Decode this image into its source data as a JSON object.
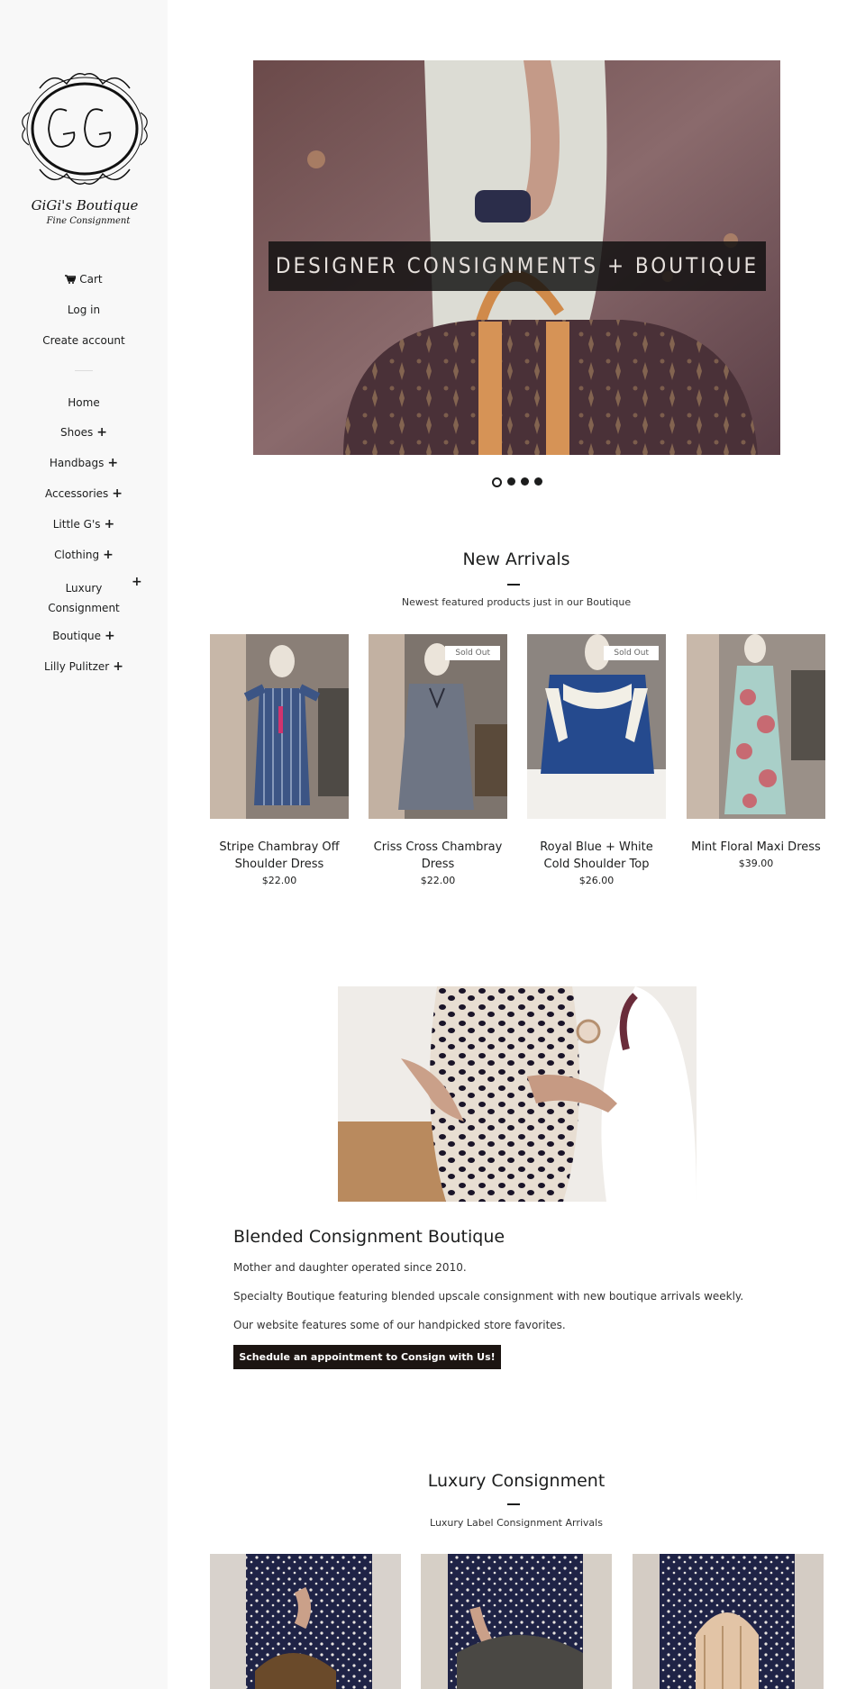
{
  "store": {
    "logo_text_line1": "GiGi's Boutique",
    "logo_text_line2": "Fine Consignment"
  },
  "account_nav": [
    {
      "label": "Cart"
    },
    {
      "label": "Log in"
    },
    {
      "label": "Create account"
    }
  ],
  "main_nav": [
    {
      "label": "Home",
      "expandable": false
    },
    {
      "label": "Shoes",
      "expandable": true
    },
    {
      "label": "Handbags",
      "expandable": true
    },
    {
      "label": "Accessories",
      "expandable": true
    },
    {
      "label": "Little G's",
      "expandable": true
    },
    {
      "label": "Clothing",
      "expandable": true
    },
    {
      "label": "Luxury Consignment",
      "expandable": true
    },
    {
      "label": "Boutique",
      "expandable": true
    },
    {
      "label": "Lilly Pulitzer",
      "expandable": true
    }
  ],
  "plus_glyph": "+",
  "hero": {
    "caption": "DESIGNER CONSIGNMENTS + BOUTIQUE",
    "slide_count": 4,
    "active_slide": 1
  },
  "new_arrivals": {
    "title": "New Arrivals",
    "subtitle": "Newest featured products just in our Boutique",
    "products": [
      {
        "name": "Stripe Chambray Off Shoulder Dress",
        "price": "$22.00",
        "badge": ""
      },
      {
        "name": "Criss Cross Chambray Dress",
        "price": "$22.00",
        "badge": "Sold Out"
      },
      {
        "name": "Royal Blue + White Cold Shoulder Top",
        "price": "$26.00",
        "badge": "Sold Out"
      },
      {
        "name": "Mint Floral Maxi Dress",
        "price": "$39.00",
        "badge": ""
      }
    ]
  },
  "feature": {
    "title": "Blended Consignment Boutique",
    "paragraphs": [
      "Mother and daughter operated since 2010.",
      "Specialty Boutique featuring blended upscale consignment with new boutique arrivals weekly.",
      "Our website features some of our handpicked store favorites."
    ],
    "cta_label": "Schedule an appointment to Consign with Us!"
  },
  "luxury": {
    "title": "Luxury Consignment",
    "subtitle": "Luxury Label Consignment Arrivals"
  },
  "colors": {
    "sidebar_bg": "#f8f8f8",
    "text": "#1c1d1d",
    "cta_bg": "#1c1512"
  }
}
